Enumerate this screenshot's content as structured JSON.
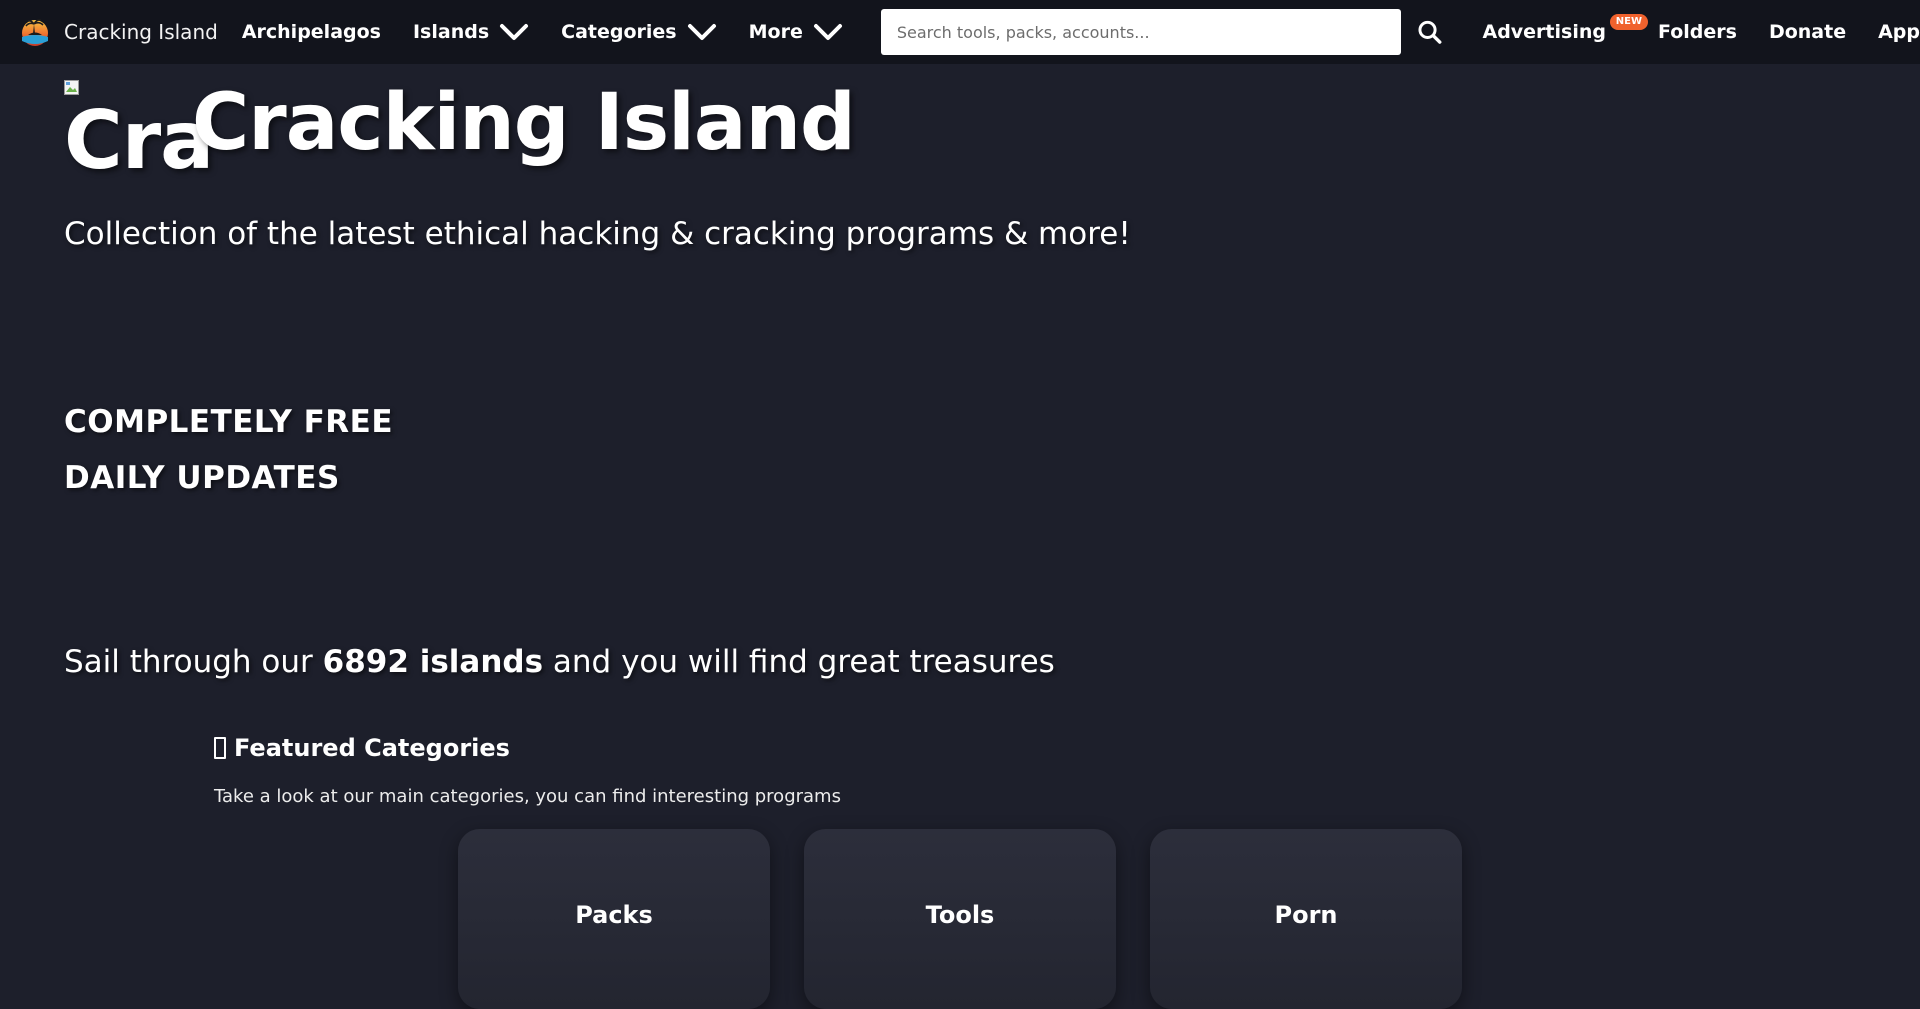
{
  "nav": {
    "brand": "Cracking Island",
    "links": {
      "archipelagos": "Archipelagos",
      "islands": "Islands",
      "categories": "Categories",
      "more": "More"
    },
    "search_placeholder": "Search tools, packs, accounts...",
    "right": {
      "advertising": "Advertising",
      "new_badge": "NEW",
      "folders": "Folders",
      "donate": "Donate",
      "app": "App"
    }
  },
  "hero": {
    "broken_alt": "Cra",
    "title": "Cracking Island",
    "subtitle": "Collection of the latest ethical hacking & cracking programs & more!",
    "feature_1": "COMPLETELY FREE",
    "feature_2": "DAILY UPDATES",
    "sail_prefix": "Sail through our ",
    "sail_count": "6892 islands",
    "sail_suffix": " and you will find great treasures"
  },
  "featured": {
    "title": "Featured Categories",
    "description": "Take a look at our main categories, you can find interesting programs",
    "cards": [
      {
        "label": "Packs"
      },
      {
        "label": "Tools"
      },
      {
        "label": "Porn"
      }
    ]
  },
  "colors": {
    "background": "#1d1f2b",
    "navbar": "#12141c",
    "badge": "#f0622d",
    "card": "#2c2e3b"
  },
  "icons": {
    "brand": "island-logo-icon",
    "dropdown": "chevron-down-icon",
    "search": "search-icon",
    "broken_image": "broken-image-icon",
    "featured": "missing-glyph-icon"
  }
}
